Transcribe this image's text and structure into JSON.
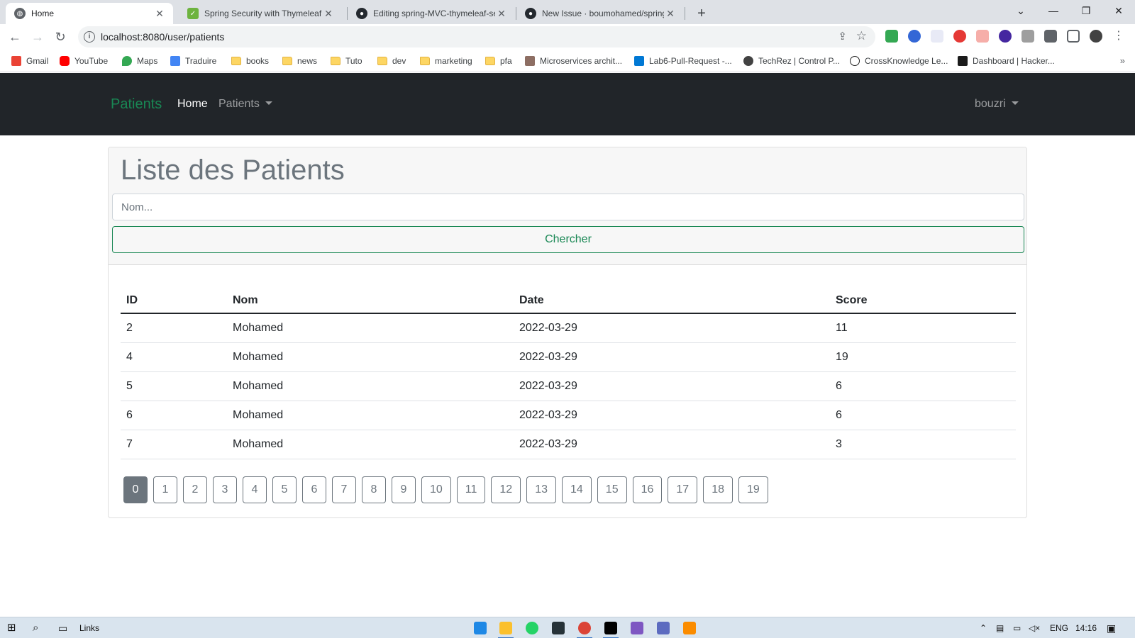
{
  "browser": {
    "tabs": [
      {
        "title": "Home",
        "active": true
      },
      {
        "title": "Spring Security with Thymeleaf | B",
        "active": false
      },
      {
        "title": "Editing spring-MVC-thymeleaf-se",
        "active": false
      },
      {
        "title": "New Issue · boumohamed/spring",
        "active": false
      }
    ],
    "new_tab": "+",
    "url": "localhost:8080/user/patients",
    "bookmarks": [
      "Gmail",
      "YouTube",
      "Maps",
      "Traduire",
      "books",
      "news",
      "Tuto",
      "dev",
      "marketing",
      "pfa",
      "Microservices archit...",
      "Lab6-Pull-Request -...",
      "TechRez | Control P...",
      "CrossKnowledge Le...",
      "Dashboard | Hacker..."
    ],
    "bookmarks_more": "»"
  },
  "nav": {
    "brand": "Patients",
    "home": "Home",
    "patients": "Patients",
    "user": "bouzri"
  },
  "page": {
    "title": "Liste des Patients",
    "search_placeholder": "Nom...",
    "search_value": "",
    "search_button": "Chercher"
  },
  "table": {
    "headers": [
      "ID",
      "Nom",
      "Date",
      "Score"
    ],
    "rows": [
      [
        "2",
        "Mohamed",
        "2022-03-29",
        "11"
      ],
      [
        "4",
        "Mohamed",
        "2022-03-29",
        "19"
      ],
      [
        "5",
        "Mohamed",
        "2022-03-29",
        "6"
      ],
      [
        "6",
        "Mohamed",
        "2022-03-29",
        "6"
      ],
      [
        "7",
        "Mohamed",
        "2022-03-29",
        "3"
      ]
    ]
  },
  "pagination": {
    "pages": [
      "0",
      "1",
      "2",
      "3",
      "4",
      "5",
      "6",
      "7",
      "8",
      "9",
      "10",
      "11",
      "12",
      "13",
      "14",
      "15",
      "16",
      "17",
      "18",
      "19"
    ],
    "current": "0"
  },
  "taskbar": {
    "links": "Links",
    "lang": "ENG",
    "time": "14:16"
  },
  "colors": {
    "brand": "#198754",
    "navbar": "#212529",
    "pager_active": "#6c757d"
  }
}
